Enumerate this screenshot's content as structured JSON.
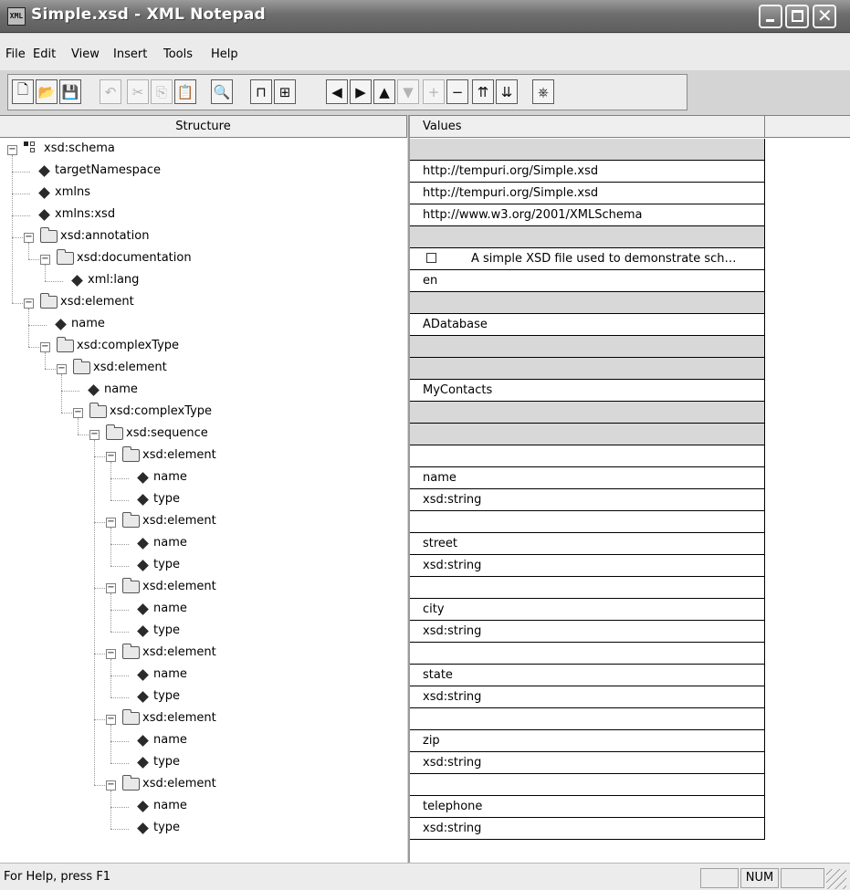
{
  "window": {
    "title": "Simple.xsd - XML Notepad",
    "app_icon_text": "XML"
  },
  "menu": [
    "File",
    "Edit",
    "View",
    "Insert",
    "Tools",
    "Help"
  ],
  "toolbar": [
    {
      "icon": "new-document-icon",
      "glyph": "🗋",
      "enabled": true
    },
    {
      "icon": "open-folder-icon",
      "glyph": "📂",
      "enabled": true
    },
    {
      "icon": "save-disk-icon",
      "glyph": "💾",
      "enabled": true
    },
    {
      "icon": "undo-icon",
      "glyph": "↶",
      "enabled": false
    },
    {
      "icon": "cut-scissors-icon",
      "glyph": "✂",
      "enabled": false
    },
    {
      "icon": "copy-icon",
      "glyph": "⎘",
      "enabled": false
    },
    {
      "icon": "paste-clipboard-icon",
      "glyph": "📋",
      "enabled": true
    },
    {
      "icon": "find-binoculars-icon",
      "glyph": "🔍",
      "enabled": true
    },
    {
      "icon": "insert-element-icon",
      "glyph": "⊓",
      "enabled": true
    },
    {
      "icon": "insert-child-icon",
      "glyph": "⊞",
      "enabled": true
    },
    {
      "icon": "arrow-left-icon",
      "glyph": "◀",
      "enabled": true
    },
    {
      "icon": "arrow-right-icon",
      "glyph": "▶",
      "enabled": true
    },
    {
      "icon": "arrow-up-icon",
      "glyph": "▲",
      "enabled": true
    },
    {
      "icon": "arrow-down-icon",
      "glyph": "▼",
      "enabled": false
    },
    {
      "icon": "expand-plus-icon",
      "glyph": "+",
      "enabled": false
    },
    {
      "icon": "collapse-minus-icon",
      "glyph": "−",
      "enabled": true
    },
    {
      "icon": "sort-ascending-icon",
      "glyph": "⇈",
      "enabled": true
    },
    {
      "icon": "sort-descending-icon",
      "glyph": "⇊",
      "enabled": true
    },
    {
      "icon": "schema-book-icon",
      "glyph": "⎈",
      "enabled": true
    }
  ],
  "columns": {
    "structure": "Structure",
    "values": "Values"
  },
  "tree": [
    {
      "label": "xsd:schema",
      "kind": "schema",
      "depth": 0,
      "value": "",
      "value_gray": true
    },
    {
      "label": "targetNamespace",
      "kind": "attr",
      "depth": 1,
      "value": "http://tempuri.org/Simple.xsd",
      "value_gray": false
    },
    {
      "label": "xmlns",
      "kind": "attr",
      "depth": 1,
      "value": "http://tempuri.org/Simple.xsd",
      "value_gray": false
    },
    {
      "label": "xmlns:xsd",
      "kind": "attr",
      "depth": 1,
      "value": "http://www.w3.org/2001/XMLSchema",
      "value_gray": false
    },
    {
      "label": "xsd:annotation",
      "kind": "folder",
      "depth": 1,
      "value": "",
      "value_gray": true
    },
    {
      "label": "xsd:documentation",
      "kind": "folder",
      "depth": 2,
      "value": "A simple XSD file used to demonstrate sch…",
      "value_gray": false,
      "value_box": true
    },
    {
      "label": "xml:lang",
      "kind": "attr",
      "depth": 3,
      "value": "en",
      "value_gray": false
    },
    {
      "label": "xsd:element",
      "kind": "folder",
      "depth": 1,
      "value": "",
      "value_gray": true
    },
    {
      "label": "name",
      "kind": "attr",
      "depth": 2,
      "value": "ADatabase",
      "value_gray": false
    },
    {
      "label": "xsd:complexType",
      "kind": "folder",
      "depth": 2,
      "value": "",
      "value_gray": true
    },
    {
      "label": "xsd:element",
      "kind": "folder",
      "depth": 3,
      "value": "",
      "value_gray": true
    },
    {
      "label": "name",
      "kind": "attr",
      "depth": 4,
      "value": "MyContacts",
      "value_gray": false
    },
    {
      "label": "xsd:complexType",
      "kind": "folder",
      "depth": 4,
      "value": "",
      "value_gray": true
    },
    {
      "label": "xsd:sequence",
      "kind": "folder",
      "depth": 5,
      "value": "",
      "value_gray": true
    },
    {
      "label": "xsd:element",
      "kind": "folder",
      "depth": 6,
      "value": "",
      "value_gray": false
    },
    {
      "label": "name",
      "kind": "attr",
      "depth": 7,
      "value": "name",
      "value_gray": false
    },
    {
      "label": "type",
      "kind": "attr",
      "depth": 7,
      "value": "xsd:string",
      "value_gray": false
    },
    {
      "label": "xsd:element",
      "kind": "folder",
      "depth": 6,
      "value": "",
      "value_gray": false
    },
    {
      "label": "name",
      "kind": "attr",
      "depth": 7,
      "value": "street",
      "value_gray": false
    },
    {
      "label": "type",
      "kind": "attr",
      "depth": 7,
      "value": "xsd:string",
      "value_gray": false
    },
    {
      "label": "xsd:element",
      "kind": "folder",
      "depth": 6,
      "value": "",
      "value_gray": false
    },
    {
      "label": "name",
      "kind": "attr",
      "depth": 7,
      "value": "city",
      "value_gray": false
    },
    {
      "label": "type",
      "kind": "attr",
      "depth": 7,
      "value": "xsd:string",
      "value_gray": false
    },
    {
      "label": "xsd:element",
      "kind": "folder",
      "depth": 6,
      "value": "",
      "value_gray": false
    },
    {
      "label": "name",
      "kind": "attr",
      "depth": 7,
      "value": "state",
      "value_gray": false
    },
    {
      "label": "type",
      "kind": "attr",
      "depth": 7,
      "value": "xsd:string",
      "value_gray": false
    },
    {
      "label": "xsd:element",
      "kind": "folder",
      "depth": 6,
      "value": "",
      "value_gray": false
    },
    {
      "label": "name",
      "kind": "attr",
      "depth": 7,
      "value": "zip",
      "value_gray": false
    },
    {
      "label": "type",
      "kind": "attr",
      "depth": 7,
      "value": "xsd:string",
      "value_gray": false
    },
    {
      "label": "xsd:element",
      "kind": "folder",
      "depth": 6,
      "value": "",
      "value_gray": false
    },
    {
      "label": "name",
      "kind": "attr",
      "depth": 7,
      "value": "telephone",
      "value_gray": false
    },
    {
      "label": "type",
      "kind": "attr",
      "depth": 7,
      "value": "xsd:string",
      "value_gray": false
    }
  ],
  "status": {
    "help_text": "For Help, press F1",
    "num_indicator": "NUM"
  }
}
